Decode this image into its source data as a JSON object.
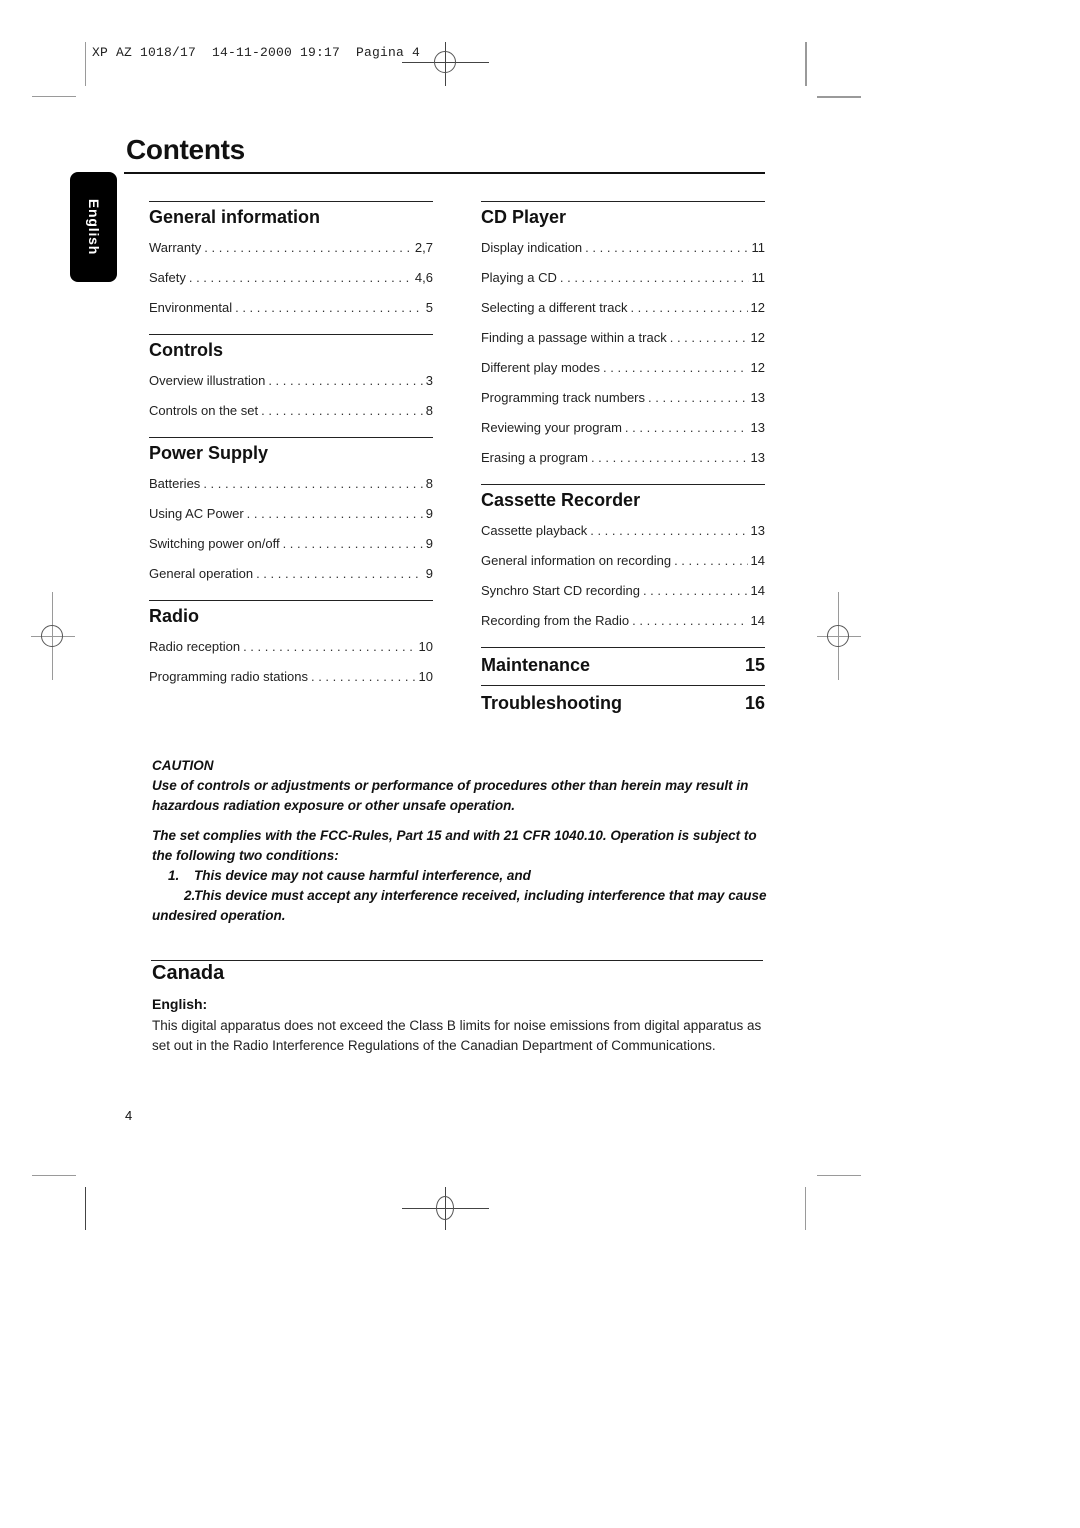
{
  "slug": "XP AZ 1018/17  14-11-2000 19:17  Pagina 4",
  "title": "Contents",
  "language_tab": "English",
  "left_column": [
    {
      "heading": "General information",
      "entries": [
        {
          "label": "Warranty",
          "page": "2,7"
        },
        {
          "label": "Safety",
          "page": "4,6"
        },
        {
          "label": "Environmental",
          "page": "5"
        }
      ]
    },
    {
      "heading": "Controls",
      "entries": [
        {
          "label": "Overview illustration",
          "page": "3"
        },
        {
          "label": "Controls on the set",
          "page": "8"
        }
      ]
    },
    {
      "heading": "Power Supply",
      "entries": [
        {
          "label": "Batteries",
          "page": "8"
        },
        {
          "label": "Using AC Power",
          "page": "9"
        },
        {
          "label": "Switching power on/off",
          "page": "9"
        },
        {
          "label": "General operation",
          "page": "9"
        }
      ]
    },
    {
      "heading": "Radio",
      "entries": [
        {
          "label": "Radio reception",
          "page": "10"
        },
        {
          "label": "Programming radio stations",
          "page": "10"
        }
      ]
    }
  ],
  "right_column": [
    {
      "heading": "CD Player",
      "entries": [
        {
          "label": "Display indication",
          "page": "11"
        },
        {
          "label": "Playing a CD",
          "page": "11"
        },
        {
          "label": "Selecting a different track",
          "page": "12"
        },
        {
          "label": "Finding a passage within a track",
          "page": "12"
        },
        {
          "label": "Different play modes",
          "page": "12"
        },
        {
          "label": "Programming track numbers",
          "page": "13"
        },
        {
          "label": "Reviewing your program",
          "page": "13"
        },
        {
          "label": "Erasing a program",
          "page": "13"
        }
      ]
    },
    {
      "heading": "Cassette Recorder",
      "entries": [
        {
          "label": "Cassette playback",
          "page": "13"
        },
        {
          "label": "General information on recording",
          "page": "14"
        },
        {
          "label": "Synchro Start CD recording",
          "page": "14"
        },
        {
          "label": "Recording from the Radio",
          "page": "14"
        }
      ]
    }
  ],
  "solo_sections": [
    {
      "heading": "Maintenance",
      "page": "15"
    },
    {
      "heading": "Troubleshooting",
      "page": "16"
    }
  ],
  "caution": {
    "heading": "CAUTION",
    "text": "Use of controls or adjustments or performance of procedures other than herein may result in hazardous radiation exposure or other unsafe operation.",
    "fcc": "The set complies with the FCC-Rules, Part 15 and with 21 CFR 1040.10.  Operation is subject to the following two conditions:",
    "conditions": [
      {
        "num": "1.",
        "text": "This device may not cause harmful interference, and"
      },
      {
        "num": "2.",
        "text": "This device must accept any interference received, including interference that may cause undesired operation."
      }
    ]
  },
  "canada": {
    "heading": "Canada",
    "subheading": "English:",
    "body": "This digital apparatus does not exceed the Class B limits for noise emissions from digital apparatus as set out in the Radio Interference Regulations of the Canadian Department of Communications."
  },
  "page_number": "4"
}
